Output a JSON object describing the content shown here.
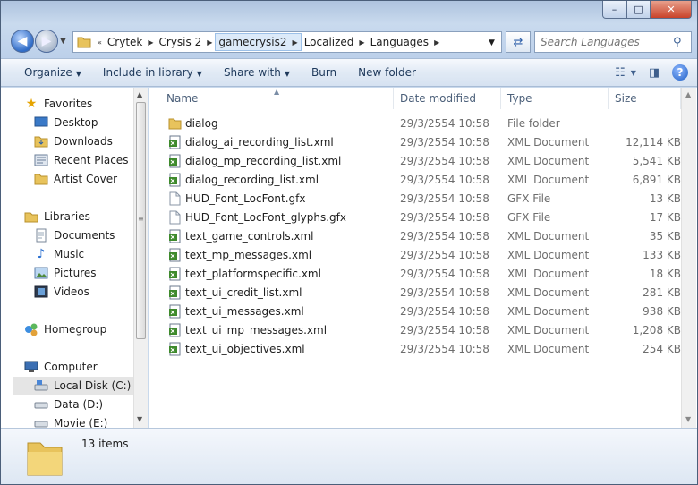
{
  "window": {
    "caption_buttons": {
      "minimize": "–",
      "maximize": "□",
      "close": "✕"
    }
  },
  "address": {
    "overflow": "«",
    "breadcrumbs": [
      "Crytek",
      "Crysis 2",
      "gamecrysis2",
      "Localized",
      "Languages"
    ],
    "selected_index": 2
  },
  "search": {
    "placeholder": "Search Languages",
    "value": ""
  },
  "toolbar": {
    "organize": "Organize",
    "include_in_library": "Include in library",
    "share_with": "Share with",
    "burn": "Burn",
    "new_folder": "New folder"
  },
  "nav": {
    "favorites": "Favorites",
    "desktop": "Desktop",
    "downloads": "Downloads",
    "recent_places": "Recent Places",
    "artist_cover": "Artist Cover",
    "libraries": "Libraries",
    "documents": "Documents",
    "music": "Music",
    "pictures": "Pictures",
    "videos": "Videos",
    "homegroup": "Homegroup",
    "computer": "Computer",
    "local_disk": "Local Disk (C:)",
    "data_d": "Data (D:)",
    "movie_e": "Movie (E:)"
  },
  "columns": {
    "name": "Name",
    "date": "Date modified",
    "type": "Type",
    "size": "Size"
  },
  "files": [
    {
      "name": "dialog",
      "date": "29/3/2554 10:58",
      "type": "File folder",
      "size": "",
      "icon": "folder"
    },
    {
      "name": "dialog_ai_recording_list.xml",
      "date": "29/3/2554 10:58",
      "type": "XML Document",
      "size": "12,114 KB",
      "icon": "xml"
    },
    {
      "name": "dialog_mp_recording_list.xml",
      "date": "29/3/2554 10:58",
      "type": "XML Document",
      "size": "5,541 KB",
      "icon": "xml"
    },
    {
      "name": "dialog_recording_list.xml",
      "date": "29/3/2554 10:58",
      "type": "XML Document",
      "size": "6,891 KB",
      "icon": "xml"
    },
    {
      "name": "HUD_Font_LocFont.gfx",
      "date": "29/3/2554 10:58",
      "type": "GFX File",
      "size": "13 KB",
      "icon": "file"
    },
    {
      "name": "HUD_Font_LocFont_glyphs.gfx",
      "date": "29/3/2554 10:58",
      "type": "GFX File",
      "size": "17 KB",
      "icon": "file"
    },
    {
      "name": "text_game_controls.xml",
      "date": "29/3/2554 10:58",
      "type": "XML Document",
      "size": "35 KB",
      "icon": "xml"
    },
    {
      "name": "text_mp_messages.xml",
      "date": "29/3/2554 10:58",
      "type": "XML Document",
      "size": "133 KB",
      "icon": "xml"
    },
    {
      "name": "text_platformspecific.xml",
      "date": "29/3/2554 10:58",
      "type": "XML Document",
      "size": "18 KB",
      "icon": "xml"
    },
    {
      "name": "text_ui_credit_list.xml",
      "date": "29/3/2554 10:58",
      "type": "XML Document",
      "size": "281 KB",
      "icon": "xml"
    },
    {
      "name": "text_ui_messages.xml",
      "date": "29/3/2554 10:58",
      "type": "XML Document",
      "size": "938 KB",
      "icon": "xml"
    },
    {
      "name": "text_ui_mp_messages.xml",
      "date": "29/3/2554 10:58",
      "type": "XML Document",
      "size": "1,208 KB",
      "icon": "xml"
    },
    {
      "name": "text_ui_objectives.xml",
      "date": "29/3/2554 10:58",
      "type": "XML Document",
      "size": "254 KB",
      "icon": "xml"
    }
  ],
  "details": {
    "item_count": "13 items"
  },
  "colors": {
    "accent": "#1e395b",
    "folder": "#e8c35c",
    "xml_green": "#3e8a2c"
  }
}
